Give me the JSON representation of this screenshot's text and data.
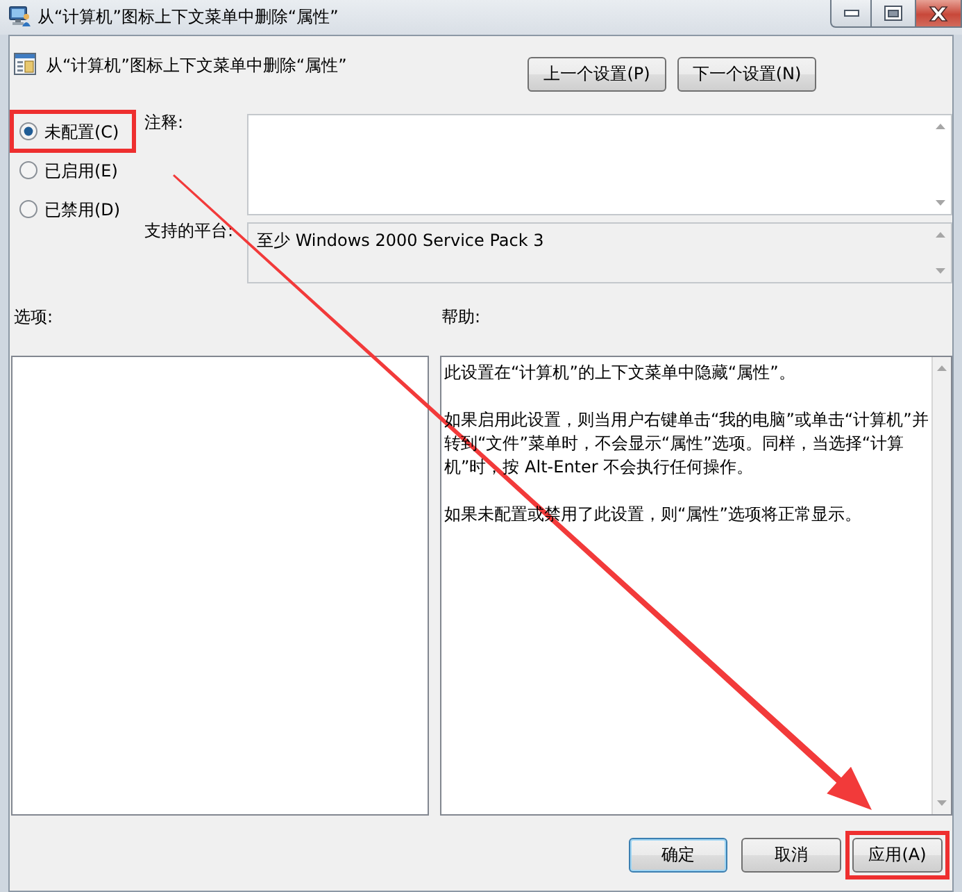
{
  "window": {
    "title": "从“计算机”图标上下文菜单中删除“属性”"
  },
  "header": {
    "title": "从“计算机”图标上下文菜单中删除“属性”",
    "buttons": [
      {
        "label": "上一个设置(P)"
      },
      {
        "label": "下一个设置(N)"
      }
    ]
  },
  "state_options": [
    {
      "label": "未配置(C)",
      "selected": true,
      "highlighted": true
    },
    {
      "label": "已启用(E)",
      "selected": false,
      "highlighted": false
    },
    {
      "label": "已禁用(D)",
      "selected": false,
      "highlighted": false
    }
  ],
  "comment": {
    "label": "注释:"
  },
  "platform": {
    "label": "支持的平台:",
    "value": "至少 Windows 2000 Service Pack 3"
  },
  "options_panel": {
    "label": "选项:"
  },
  "help_panel": {
    "label": "帮助:",
    "paragraphs": [
      "此设置在“计算机”的上下文菜单中隐藏“属性”。",
      "如果启用此设置，则当用户右键单击“我的电脑”或单击“计算机”并转到“文件”菜单时，不会显示“属性”选项。同样，当选择“计算机”时，按 Alt-Enter 不会执行任何操作。",
      "如果未配置或禁用了此设置，则“属性”选项将正常显示。"
    ]
  },
  "footer_buttons": [
    {
      "label": "确定",
      "default": true,
      "highlighted": false
    },
    {
      "label": "取消",
      "default": false,
      "highlighted": false
    },
    {
      "label": "应用(A)",
      "default": false,
      "highlighted": true
    }
  ],
  "annotation": {
    "kind": "arrow"
  }
}
